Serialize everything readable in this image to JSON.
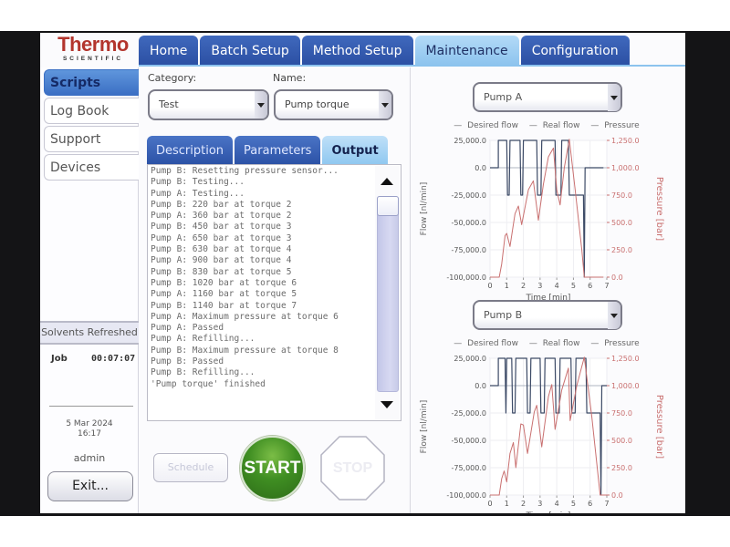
{
  "brand": {
    "name": "Thermo",
    "sub": "SCIENTIFIC",
    "color": "#b3352d"
  },
  "top_tabs": [
    {
      "label": "Home",
      "active": false
    },
    {
      "label": "Batch Setup",
      "active": false
    },
    {
      "label": "Method Setup",
      "active": false
    },
    {
      "label": "Maintenance",
      "active": true
    },
    {
      "label": "Configuration",
      "active": false
    }
  ],
  "sidebar": {
    "items": [
      {
        "label": "Scripts",
        "active": true
      },
      {
        "label": "Log Book",
        "active": false
      },
      {
        "label": "Support",
        "active": false
      },
      {
        "label": "Devices",
        "active": false
      }
    ],
    "status": "Solvents Refreshed",
    "job_label": "Job",
    "job_time": "00:07:07",
    "date": "5 Mar 2024",
    "time": "16:17",
    "user": "admin",
    "exit_label": "Exit..."
  },
  "script": {
    "category_label": "Category:",
    "category_value": "Test",
    "name_label": "Name:",
    "name_value": "Pump torque",
    "tabs": [
      {
        "label": "Description",
        "active": false
      },
      {
        "label": "Parameters",
        "active": false
      },
      {
        "label": "Output",
        "active": true
      }
    ],
    "output_lines": [
      "Pump B: Resetting pressure sensor...",
      "Pump B: Testing...",
      "Pump A: Testing...",
      "Pump B: 220 bar at torque 2",
      "Pump A: 360 bar at torque 2",
      "Pump B: 450 bar at torque 3",
      "Pump A: 650 bar at torque 3",
      "Pump B: 630 bar at torque 4",
      "Pump A: 900 bar at torque 4",
      "Pump B: 830 bar at torque 5",
      "Pump B: 1020 bar at torque 6",
      "Pump A: 1160 bar at torque 5",
      "Pump B: 1140 bar at torque 7",
      "Pump A: Maximum pressure at torque 6",
      "Pump A: Passed",
      "Pump A: Refilling...",
      "Pump B: Maximum pressure at torque 8",
      "Pump B: Passed",
      "Pump B: Refilling...",
      "'Pump torque' finished"
    ],
    "buttons": {
      "schedule": "Schedule",
      "start": "START",
      "stop": "STOP"
    },
    "colors": {
      "start": "#3f8e22"
    }
  },
  "chart_data": [
    {
      "type": "line",
      "selector": "Pump A",
      "legend": [
        "Desired flow",
        "Real flow",
        "Pressure"
      ],
      "xlabel": "Time [min]",
      "ylabel": "Flow [nl/min]",
      "y2label": "Pressure [bar]",
      "xlim": [
        0,
        7
      ],
      "ylim": [
        -100000,
        25000
      ],
      "y2lim": [
        0,
        1250
      ],
      "xticks": [
        "0",
        "1",
        "2",
        "3",
        "4",
        "5",
        "6",
        "7"
      ],
      "yticks": [
        "25,000.0",
        "0.0",
        "-25,000.0",
        "-50,000.0",
        "-75,000.0",
        "-100,000.0"
      ],
      "y2ticks": [
        "1,250.0",
        "1,000.0",
        "750.0",
        "500.0",
        "250.0",
        "0.0"
      ],
      "colors": {
        "flow": "#3c4a66",
        "pressure": "#c97070"
      },
      "series": [
        {
          "name": "Desired flow",
          "x": [
            0,
            0.5,
            0.5,
            1.0,
            1.05,
            1.15,
            1.2,
            1.8,
            1.85,
            1.95,
            2.0,
            2.8,
            2.85,
            3.05,
            3.1,
            3.9,
            3.95,
            4.25,
            4.3,
            4.7,
            4.75,
            5.6,
            5.65,
            5.7,
            6.8
          ],
          "y": [
            0,
            0,
            25000,
            25000,
            -25000,
            -25000,
            25000,
            25000,
            -25000,
            -25000,
            25000,
            25000,
            -25000,
            -25000,
            25000,
            25000,
            -25000,
            -25000,
            25000,
            25000,
            -25000,
            -25000,
            -100000,
            0,
            0
          ]
        },
        {
          "name": "Pressure",
          "x": [
            0,
            0.55,
            0.7,
            0.9,
            1.0,
            1.2,
            1.5,
            1.7,
            1.9,
            2.3,
            2.6,
            2.9,
            3.2,
            3.5,
            3.8,
            4.0,
            4.2,
            4.45,
            4.75,
            5.1,
            5.5,
            5.65,
            6.8
          ],
          "y": [
            0,
            0,
            120,
            380,
            400,
            280,
            580,
            650,
            480,
            800,
            880,
            520,
            850,
            1100,
            1180,
            800,
            660,
            1000,
            1260,
            800,
            250,
            0,
            0
          ]
        }
      ]
    },
    {
      "type": "line",
      "selector": "Pump B",
      "legend": [
        "Desired flow",
        "Real flow",
        "Pressure"
      ],
      "xlabel": "Time [min]",
      "ylabel": "Flow [nl/min]",
      "y2label": "Pressure [bar]",
      "xlim": [
        0,
        7
      ],
      "ylim": [
        -100000,
        25000
      ],
      "y2lim": [
        0,
        1250
      ],
      "xticks": [
        "0",
        "1",
        "2",
        "3",
        "4",
        "5",
        "6",
        "7"
      ],
      "yticks": [
        "25,000.0",
        "0.0",
        "-25,000.0",
        "-50,000.0",
        "-75,000.0",
        "-100,000.0"
      ],
      "y2ticks": [
        "1,250.0",
        "1,000.0",
        "750.0",
        "500.0",
        "250.0",
        "0.0"
      ],
      "colors": {
        "flow": "#3c4a66",
        "pressure": "#c97070"
      },
      "series": [
        {
          "name": "Desired flow",
          "x": [
            0,
            0.5,
            0.5,
            0.9,
            0.95,
            1.0,
            1.05,
            1.3,
            1.35,
            1.5,
            1.55,
            2.2,
            2.25,
            2.4,
            2.45,
            3.0,
            3.05,
            3.25,
            3.3,
            3.9,
            3.95,
            4.15,
            4.2,
            4.85,
            4.9,
            5.1,
            5.15,
            5.75,
            5.8,
            6.6,
            6.65,
            6.7,
            7.0
          ],
          "y": [
            0,
            0,
            25000,
            25000,
            -25000,
            25000,
            25000,
            25000,
            -25000,
            -25000,
            25000,
            25000,
            -25000,
            -25000,
            25000,
            25000,
            -25000,
            -25000,
            25000,
            25000,
            -25000,
            -25000,
            25000,
            25000,
            -25000,
            -25000,
            25000,
            25000,
            -25000,
            -25000,
            -100000,
            0,
            0
          ]
        },
        {
          "name": "Pressure",
          "x": [
            0,
            0.55,
            0.7,
            0.85,
            1.0,
            1.2,
            1.4,
            1.55,
            1.85,
            2.0,
            2.25,
            2.65,
            2.8,
            3.1,
            3.5,
            3.7,
            3.9,
            4.3,
            4.7,
            4.8,
            5.2,
            5.65,
            6.1,
            6.6,
            6.75,
            7.0
          ],
          "y": [
            0,
            0,
            150,
            220,
            120,
            380,
            480,
            250,
            650,
            640,
            380,
            760,
            820,
            440,
            900,
            1010,
            600,
            960,
            1160,
            680,
            1000,
            1260,
            720,
            0,
            0,
            0
          ]
        }
      ]
    }
  ]
}
